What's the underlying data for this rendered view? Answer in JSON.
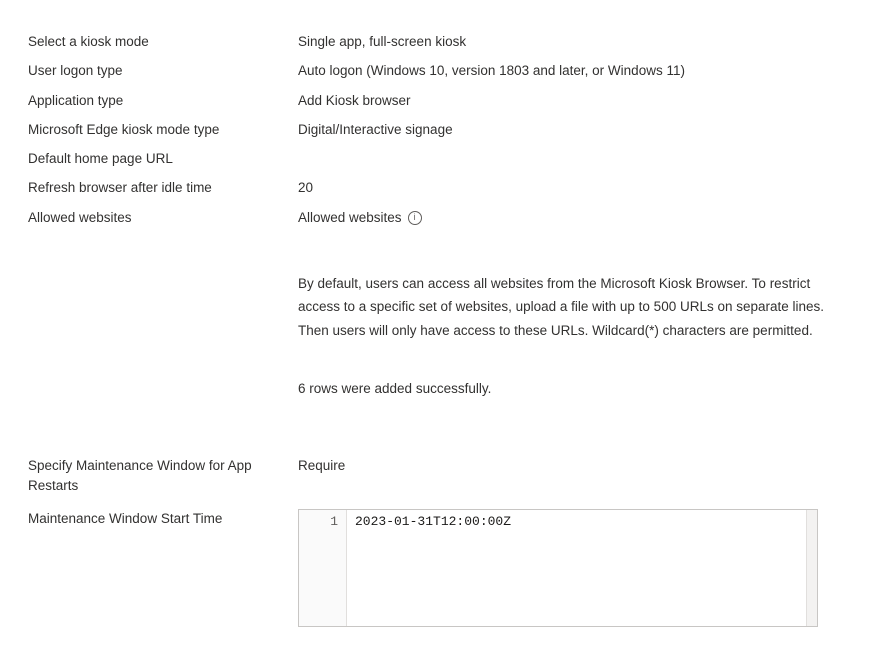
{
  "fields": {
    "kiosk_mode": {
      "label": "Select a kiosk mode",
      "value": "Single app, full-screen kiosk"
    },
    "logon_type": {
      "label": "User logon type",
      "value": "Auto logon (Windows 10, version 1803 and later, or Windows 11)"
    },
    "app_type": {
      "label": "Application type",
      "value": "Add Kiosk browser"
    },
    "edge_kiosk_type": {
      "label": "Microsoft Edge kiosk mode type",
      "value": "Digital/Interactive signage"
    },
    "home_url": {
      "label": "Default home page URL",
      "value": ""
    },
    "refresh_idle": {
      "label": "Refresh browser after idle time",
      "value": "20"
    },
    "allowed_sites": {
      "label": "Allowed websites",
      "value": "Allowed websites",
      "description": "By default, users can access all websites from the Microsoft Kiosk Browser. To restrict access to a specific set of websites, upload a file with up to 500 URLs on separate lines. Then users will only have access to these URLs. Wildcard(*) characters are permitted.",
      "status": "6 rows were added successfully."
    },
    "maintenance_window": {
      "label": "Specify Maintenance Window for App Restarts",
      "value": "Require"
    },
    "maintenance_start": {
      "label": "Maintenance Window Start Time",
      "line_number": "1",
      "line_value": "2023-01-31T12:00:00Z"
    }
  }
}
